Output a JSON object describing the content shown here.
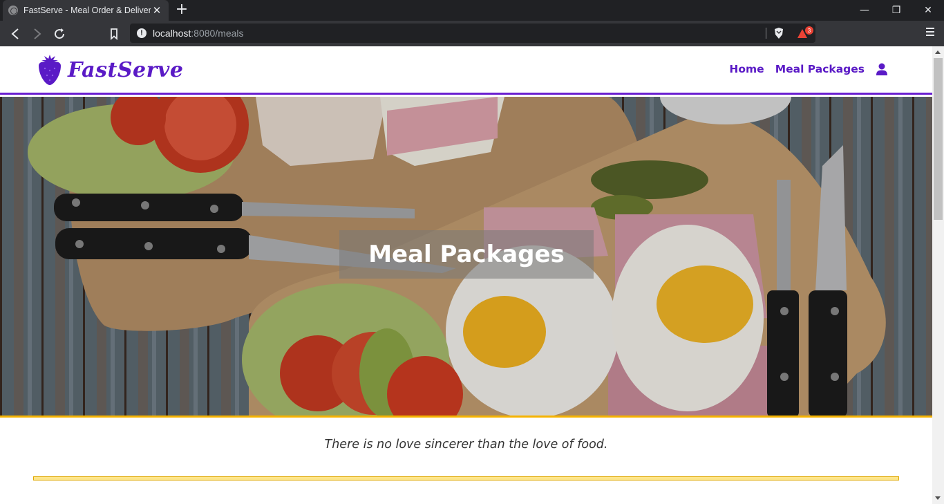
{
  "browser": {
    "tab_title": "FastServe - Meal Order & Delivery",
    "url_host": "localhost",
    "url_rest": ":8080/meals",
    "rewards_count": "3"
  },
  "site": {
    "brand": "FastServe",
    "nav": {
      "home": "Home",
      "meal_packages": "Meal Packages"
    }
  },
  "hero": {
    "title": "Meal Packages"
  },
  "quote": "There is no love sincerer than the love of food.",
  "colors": {
    "brand_purple": "#5a1ac6",
    "accent_yellow": "#f5b301"
  }
}
